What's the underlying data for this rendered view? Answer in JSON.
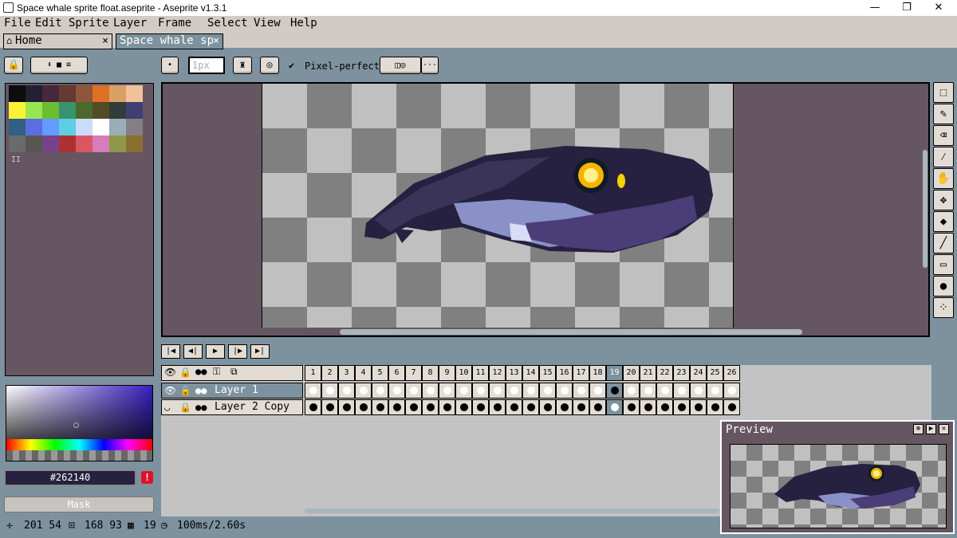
{
  "window": {
    "title": "Space whale sprite float.aseprite - Aseprite v1.3.1",
    "minimize": "—",
    "restore": "❐",
    "close": "✕"
  },
  "menu": [
    "File",
    "Edit",
    "Sprite",
    "Layer",
    "Frame",
    "Select",
    "View",
    "Help"
  ],
  "tabs": {
    "home": "Home",
    "active": "Space whale sp",
    "close": "×"
  },
  "toolbar": {
    "brush_size": "1px",
    "pixel_perfect": "Pixel-perfect"
  },
  "palette": {
    "marker": "II",
    "colors": [
      "#0d0d0d",
      "#222034",
      "#45283c",
      "#663931",
      "#8f563b",
      "#df7126",
      "#d9a066",
      "#eec39a",
      "#fbf236",
      "#99e550",
      "#6abe30",
      "#37946e",
      "#4b692f",
      "#524b24",
      "#323c39",
      "#3f3f74",
      "#306082",
      "#5b6ee1",
      "#639bff",
      "#5fcde4",
      "#cbdbfc",
      "#ffffff",
      "#9badb7",
      "#847e87",
      "#696a6a",
      "#595652",
      "#76428a",
      "#ac3232",
      "#d95763",
      "#d77bba",
      "#8f974a",
      "#8a6f30"
    ]
  },
  "color": {
    "hex": "#262140",
    "warning": "!"
  },
  "mask_label": "Mask",
  "accent": {
    "frame_highlight": "#7d929e",
    "canvas_bg": "#665661"
  },
  "timeline": {
    "frames": [
      "1",
      "2",
      "3",
      "4",
      "5",
      "6",
      "7",
      "8",
      "9",
      "10",
      "11",
      "12",
      "13",
      "14",
      "15",
      "16",
      "17",
      "18",
      "19",
      "20",
      "21",
      "22",
      "23",
      "24",
      "25",
      "26"
    ],
    "current_frame": "19",
    "layers": [
      {
        "name": "Layer 1",
        "cel": "hollow"
      },
      {
        "name": "Layer 2 Copy",
        "cel": "filled"
      }
    ]
  },
  "status": {
    "pos": "201 54",
    "size": "168 93",
    "frame": "19",
    "duration": "100ms/2.60s"
  },
  "preview": {
    "title": "Preview"
  }
}
